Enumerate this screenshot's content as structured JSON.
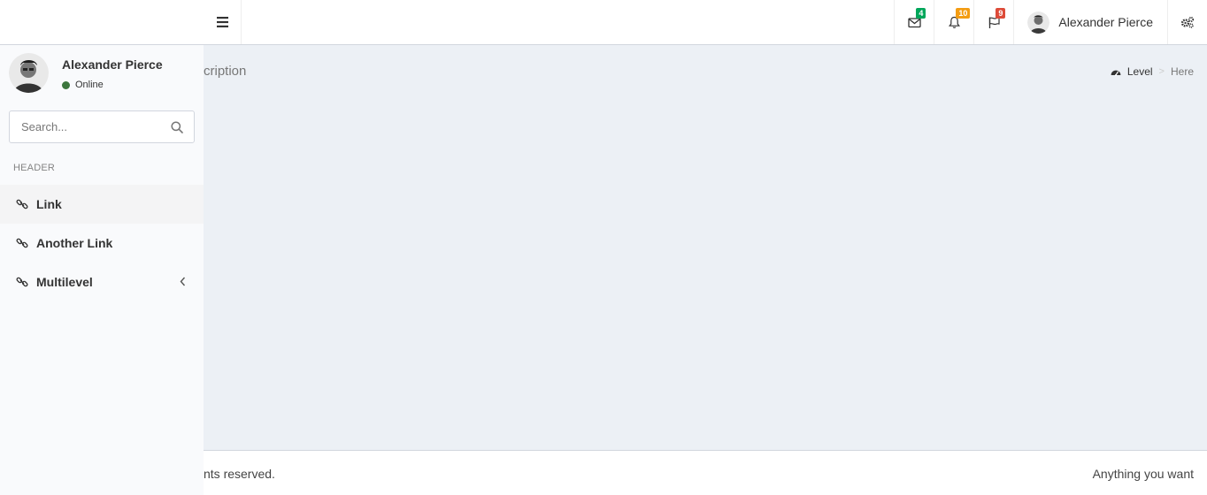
{
  "header": {
    "username": "Alexander Pierce",
    "notifications": [
      {
        "icon": "envelope-icon",
        "count": "4",
        "color": "#00a65a"
      },
      {
        "icon": "bell-icon",
        "count": "10",
        "color": "#f39c12"
      },
      {
        "icon": "flag-icon",
        "count": "9",
        "color": "#dd4b39"
      }
    ]
  },
  "sidebar": {
    "user_name": "Alexander Pierce",
    "user_status": "Online",
    "search_placeholder": "Search...",
    "menu_header": "HEADER",
    "items": [
      {
        "label": "Link",
        "icon": "link-icon",
        "active": true
      },
      {
        "label": "Another Link",
        "icon": "link-icon",
        "active": false
      },
      {
        "label": "Multilevel",
        "icon": "link-icon",
        "active": false,
        "has_children": true
      }
    ]
  },
  "content": {
    "page_description": "cription",
    "breadcrumb": {
      "level": "Level",
      "here": "Here",
      "icon": "dashboard-icon"
    }
  },
  "footer": {
    "copyright": "nts reserved.",
    "right_text": "Anything you want"
  }
}
